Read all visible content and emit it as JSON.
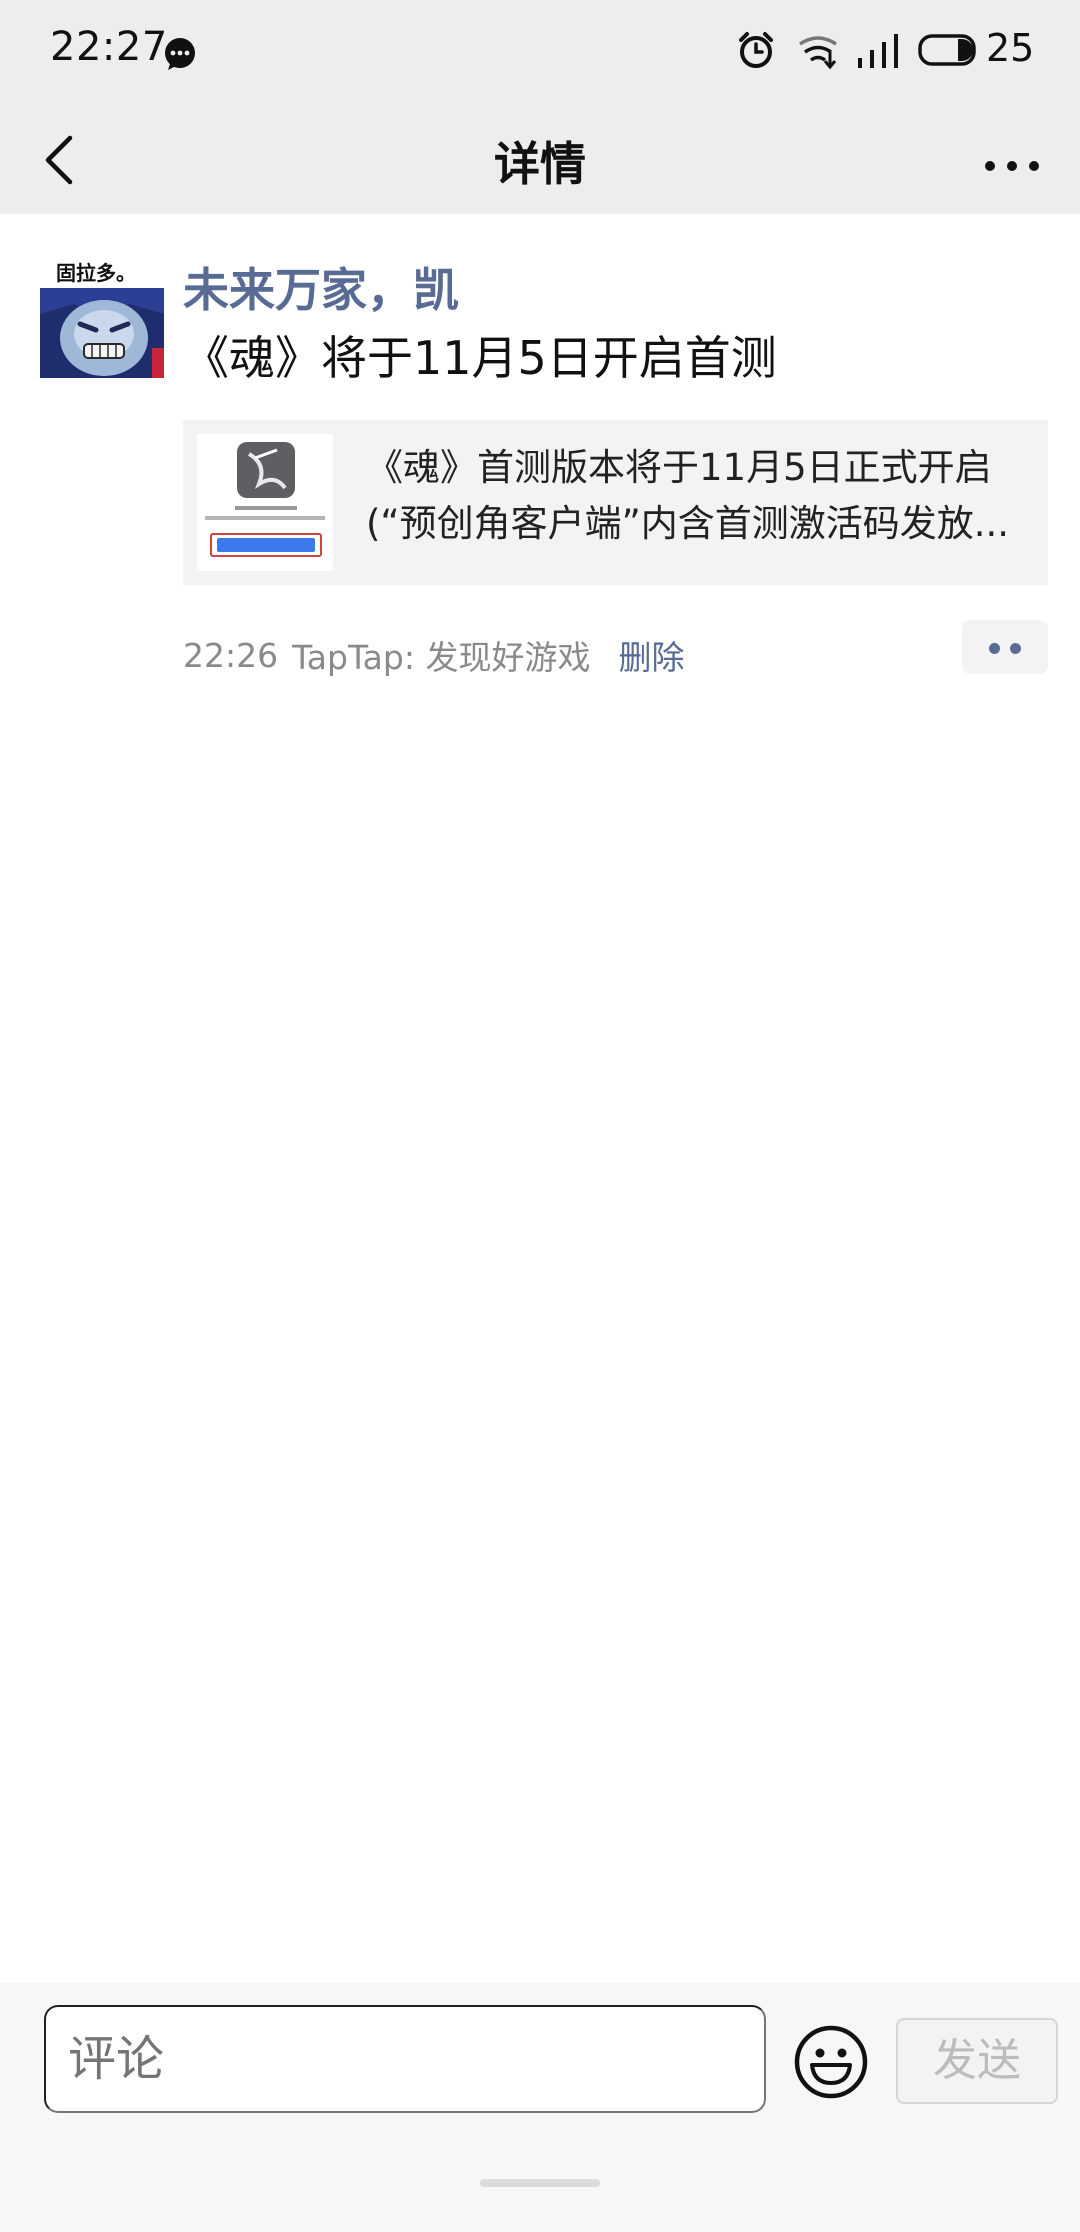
{
  "status_bar": {
    "time": "22:27",
    "battery": "25",
    "icons": [
      "message-bubble-icon",
      "alarm-icon",
      "wifi-icon",
      "signal-icon",
      "battery-icon"
    ]
  },
  "nav": {
    "title": "详情",
    "back_icon": "chevron-left-icon",
    "more_icon": "more-dots-icon"
  },
  "post": {
    "author": "未来万家，凯",
    "avatar_caption": "固拉多。",
    "text": "《魂》将于11月5日开启首测",
    "link_card": {
      "title_line1": "《魂》首测版本将于11月5日正式开启",
      "title_line2": "(“预创角客户端”内含首测激活码发放..."
    },
    "time": "22:26",
    "source": "TapTap: 发现好游戏",
    "delete_label": "删除"
  },
  "comment_bar": {
    "placeholder": "评论",
    "send_label": "发送"
  },
  "colors": {
    "link_blue": "#576b95",
    "bar_bg": "#ededed",
    "card_bg": "#f3f3f5"
  }
}
